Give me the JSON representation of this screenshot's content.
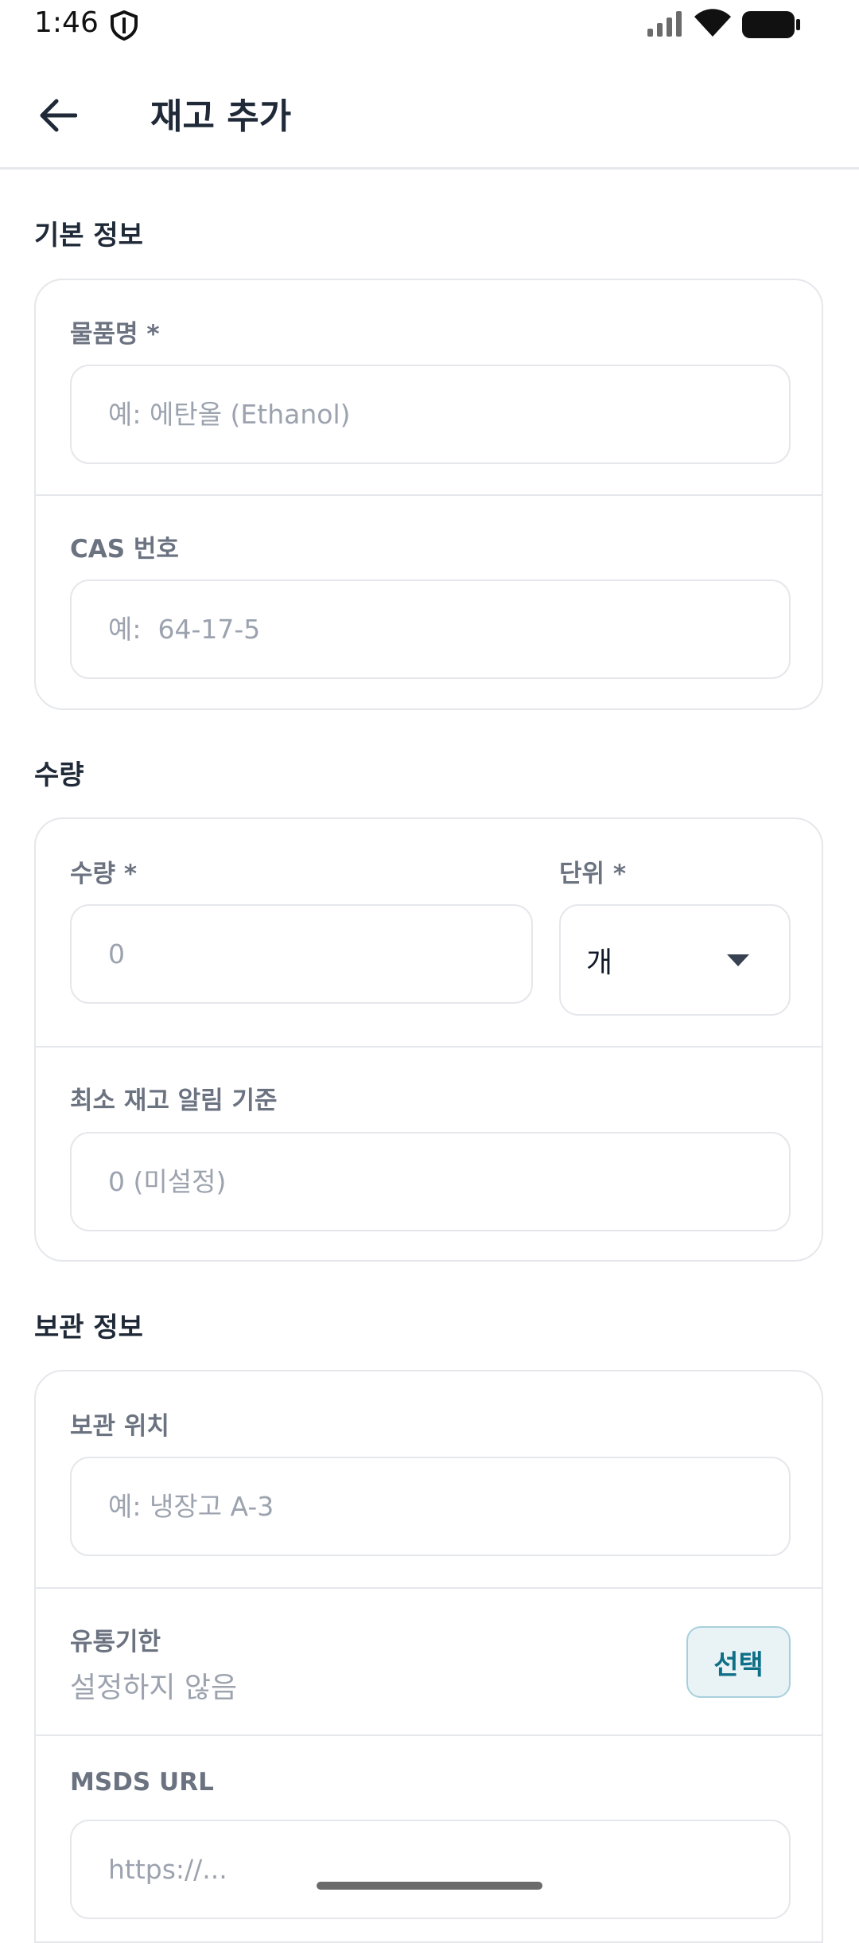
{
  "status_bar": {
    "time": "1:46"
  },
  "app_bar": {
    "title": "재고 추가"
  },
  "sections": {
    "basic": {
      "title": "기본 정보",
      "name": {
        "label": "물품명 *",
        "placeholder": "예: 에탄올 (Ethanol)"
      },
      "cas": {
        "label": "CAS 번호",
        "placeholder": "예:  64-17-5"
      }
    },
    "quantity": {
      "title": "수량",
      "amount": {
        "label": "수량 *",
        "placeholder": "0"
      },
      "unit": {
        "label": "단위 *",
        "value": "개"
      },
      "min_alert": {
        "label": "최소 재고 알림 기준",
        "placeholder": "0 (미설정)"
      }
    },
    "storage": {
      "title": "보관 정보",
      "location": {
        "label": "보관 위치",
        "placeholder": "예: 냉장고 A-3"
      },
      "expiry": {
        "label": "유통기한",
        "value": "설정하지 않음",
        "button": "선택"
      },
      "msds": {
        "label": "MSDS URL",
        "placeholder": "https://..."
      }
    }
  },
  "colors": {
    "accent": "#0e6f86",
    "accent_bg": "#e9f3f6",
    "border": "#e5e7eb",
    "label": "#6b7280",
    "placeholder": "#9ca3af"
  }
}
